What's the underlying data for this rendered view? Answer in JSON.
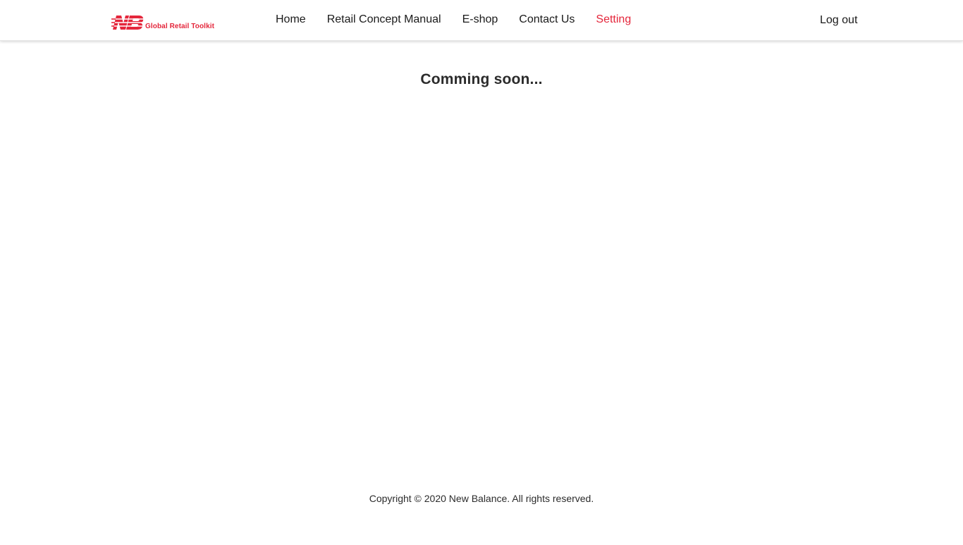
{
  "brand": {
    "logo_icon": "new-balance-nb-logo",
    "logo_text": "Global Retail Toolkit",
    "accent_color": "#e4263b"
  },
  "nav": {
    "items": [
      {
        "label": "Home",
        "active": false
      },
      {
        "label": "Retail Concept Manual",
        "active": false
      },
      {
        "label": "E-shop",
        "active": false
      },
      {
        "label": "Contact Us",
        "active": false
      },
      {
        "label": "Setting",
        "active": true
      }
    ],
    "logout_label": "Log out"
  },
  "main": {
    "message": "Comming soon..."
  },
  "footer": {
    "copyright": "Copyright © 2020 New Balance. All rights reserved."
  }
}
